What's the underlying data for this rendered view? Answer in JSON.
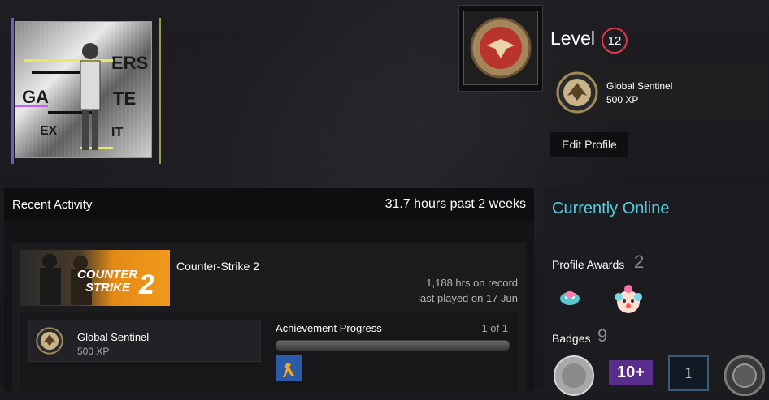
{
  "profile": {
    "level_label": "Level",
    "level_value": "12",
    "xp_card": {
      "name": "Global Sentinel",
      "xp": "500 XP"
    },
    "edit_button": "Edit Profile"
  },
  "avatar": {
    "icon": "avatar-image"
  },
  "recent_activity": {
    "title": "Recent Activity",
    "hours_summary": "31.7 hours past 2 weeks",
    "game": {
      "name": "Counter-Strike 2",
      "banner_line1": "COUNTER",
      "banner_line2": "STRIKE",
      "banner_number": "2",
      "hours_on_record": "1,188 hrs on record",
      "last_played": "last played on 17 Jun",
      "xp": {
        "name": "Global Sentinel",
        "xp": "500 XP"
      },
      "achievements": {
        "title": "Achievement Progress",
        "count": "1 of 1",
        "progress": 1.0
      }
    }
  },
  "sidebar": {
    "status": "Currently Online",
    "awards_label": "Profile Awards",
    "awards_count": "2",
    "badges_label": "Badges",
    "badges_count": "9",
    "badge_texts": [
      "10+",
      "1"
    ]
  },
  "colors": {
    "online": "#57cbde",
    "level_ring": "#d83d46",
    "banner_orange": "#f09a1a"
  }
}
